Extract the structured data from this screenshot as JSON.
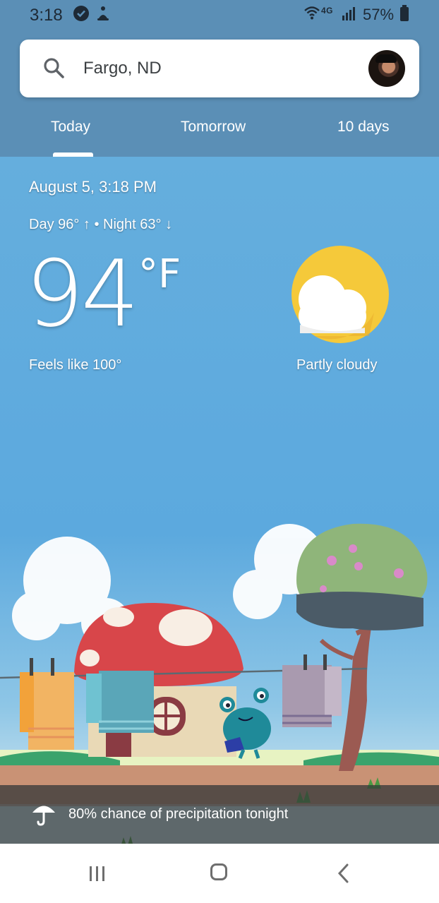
{
  "status": {
    "time": "3:18",
    "network": "4G",
    "battery": "57%"
  },
  "search": {
    "location": "Fargo, ND"
  },
  "tabs": [
    {
      "label": "Today",
      "selected": true
    },
    {
      "label": "Tomorrow",
      "selected": false
    },
    {
      "label": "10 days",
      "selected": false
    }
  ],
  "weather": {
    "datetime": "August 5, 3:18 PM",
    "day_night": "Day 96° ↑ • Night 63° ↓",
    "temperature": "94",
    "unit": "°F",
    "feels_like": "Feels like 100°",
    "condition": "Partly cloudy",
    "condition_icon": "partly-cloudy-icon"
  },
  "precipitation": {
    "text": "80% chance of precipitation tonight",
    "icon": "umbrella-icon"
  },
  "colors": {
    "header_bg": "#5b8fb6",
    "sky_top": "#65aedd",
    "sun": "#f5c93a",
    "cloud": "#ffffff"
  }
}
